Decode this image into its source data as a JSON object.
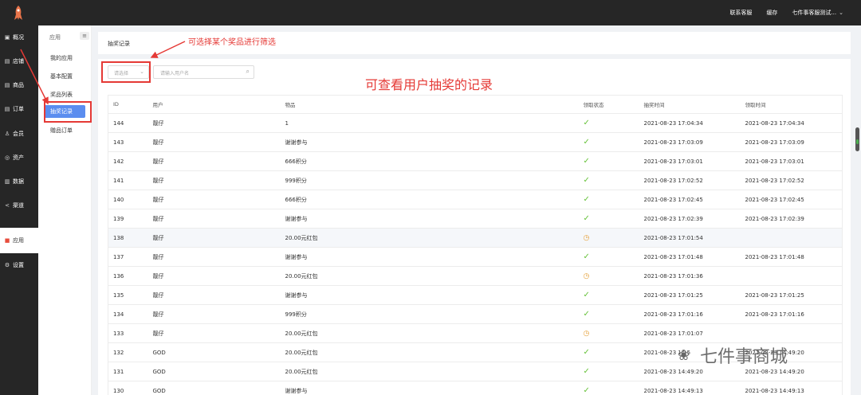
{
  "topbar": {
    "contact": "联系客服",
    "cache": "缓存",
    "account": "七件事客服测试..."
  },
  "leftnav": [
    {
      "icon": "dashboard-icon",
      "glyph": "▣",
      "label": "概况",
      "active": false
    },
    {
      "icon": "store-icon",
      "glyph": "▤",
      "label": "店铺",
      "active": false
    },
    {
      "icon": "goods-icon",
      "glyph": "▤",
      "label": "商品",
      "active": false
    },
    {
      "icon": "order-icon",
      "glyph": "▤",
      "label": "订单",
      "active": false
    },
    {
      "icon": "member-icon",
      "glyph": "♙",
      "label": "会员",
      "active": false
    },
    {
      "icon": "asset-icon",
      "glyph": "◎",
      "label": "资产",
      "active": false
    },
    {
      "icon": "data-icon",
      "glyph": "▥",
      "label": "数据",
      "active": false
    },
    {
      "icon": "channel-icon",
      "glyph": "<",
      "label": "渠道",
      "active": false
    },
    {
      "icon": "apps-icon",
      "glyph": "■",
      "label": "应用",
      "active": true
    },
    {
      "icon": "settings-icon",
      "glyph": "⚙",
      "label": "设置",
      "active": false
    }
  ],
  "subnav": {
    "head": "应用",
    "items": [
      "我的应用",
      "基本配置",
      "奖品列表",
      "抽奖记录",
      "赠品订单"
    ],
    "active_index": 3
  },
  "breadcrumb": "抽奖记录",
  "filters": {
    "select_placeholder": "请选择",
    "search_placeholder": "请输入用户名"
  },
  "table": {
    "columns": [
      "ID",
      "用户",
      "物品",
      "领取状态",
      "抽奖时间",
      "领取时间"
    ],
    "rows": [
      {
        "id": "144",
        "user": "靓仔",
        "item": "1",
        "status": "ok",
        "draw_time": "2021-08-23 17:04:34",
        "claim_time": "2021-08-23 17:04:34"
      },
      {
        "id": "143",
        "user": "靓仔",
        "item": "谢谢参与",
        "status": "ok",
        "draw_time": "2021-08-23 17:03:09",
        "claim_time": "2021-08-23 17:03:09"
      },
      {
        "id": "142",
        "user": "靓仔",
        "item": "666积分",
        "status": "ok",
        "draw_time": "2021-08-23 17:03:01",
        "claim_time": "2021-08-23 17:03:01"
      },
      {
        "id": "141",
        "user": "靓仔",
        "item": "999积分",
        "status": "ok",
        "draw_time": "2021-08-23 17:02:52",
        "claim_time": "2021-08-23 17:02:52"
      },
      {
        "id": "140",
        "user": "靓仔",
        "item": "666积分",
        "status": "ok",
        "draw_time": "2021-08-23 17:02:45",
        "claim_time": "2021-08-23 17:02:45"
      },
      {
        "id": "139",
        "user": "靓仔",
        "item": "谢谢参与",
        "status": "ok",
        "draw_time": "2021-08-23 17:02:39",
        "claim_time": "2021-08-23 17:02:39"
      },
      {
        "id": "138",
        "user": "靓仔",
        "item": "20.00元红包",
        "status": "pending",
        "draw_time": "2021-08-23 17:01:54",
        "claim_time": ""
      },
      {
        "id": "137",
        "user": "靓仔",
        "item": "谢谢参与",
        "status": "ok",
        "draw_time": "2021-08-23 17:01:48",
        "claim_time": "2021-08-23 17:01:48"
      },
      {
        "id": "136",
        "user": "靓仔",
        "item": "20.00元红包",
        "status": "pending",
        "draw_time": "2021-08-23 17:01:36",
        "claim_time": ""
      },
      {
        "id": "135",
        "user": "靓仔",
        "item": "谢谢参与",
        "status": "ok",
        "draw_time": "2021-08-23 17:01:25",
        "claim_time": "2021-08-23 17:01:25"
      },
      {
        "id": "134",
        "user": "靓仔",
        "item": "999积分",
        "status": "ok",
        "draw_time": "2021-08-23 17:01:16",
        "claim_time": "2021-08-23 17:01:16"
      },
      {
        "id": "133",
        "user": "靓仔",
        "item": "20.00元红包",
        "status": "pending",
        "draw_time": "2021-08-23 17:01:07",
        "claim_time": ""
      },
      {
        "id": "132",
        "user": "GOD",
        "item": "20.00元红包",
        "status": "ok",
        "draw_time": "2021-08-23 14:5",
        "claim_time": "2021-08-23 14:49:20"
      },
      {
        "id": "131",
        "user": "GOD",
        "item": "20.00元红包",
        "status": "ok",
        "draw_time": "2021-08-23 14:49:20",
        "claim_time": "2021-08-23 14:49:20"
      },
      {
        "id": "130",
        "user": "GOD",
        "item": "谢谢参与",
        "status": "ok",
        "draw_time": "2021-08-23 14:49:13",
        "claim_time": "2021-08-23 14:49:13"
      }
    ],
    "highlighted_row_index": 6
  },
  "annotations": {
    "filter_note": "可选择某个奖品进行筛选",
    "record_note": "可查看用户抽奖的记录",
    "color": "#e53935"
  },
  "watermark": "七件事商城"
}
